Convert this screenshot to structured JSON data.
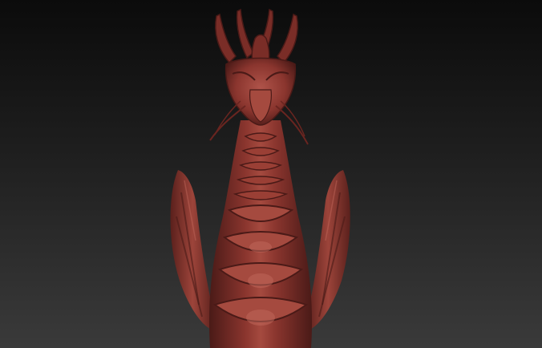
{
  "scene": {
    "subject": "dragon-sculpt",
    "colors": {
      "background_top": "#0b0b0b",
      "background_bottom": "#3a3a3a",
      "clay_dark": "#4a1a17",
      "clay_mid": "#7a2d27",
      "clay_light": "#a54a3f",
      "clay_highlight": "#c0665a"
    }
  }
}
